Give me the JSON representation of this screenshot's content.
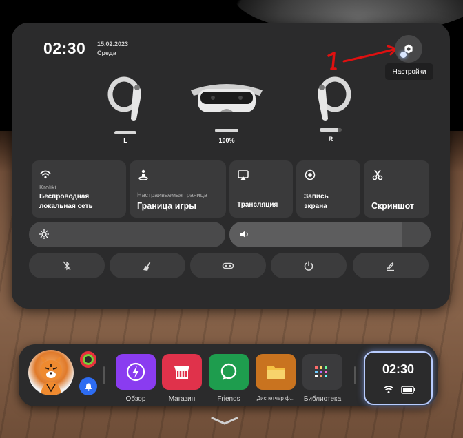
{
  "status": {
    "time": "02:30",
    "date": "15.02.2023",
    "weekday": "Среда"
  },
  "settings": {
    "tooltip": "Настройки",
    "annotation": "1"
  },
  "devices": {
    "left": {
      "label": "L",
      "battery": 1.0
    },
    "headset": {
      "label": "100%",
      "battery": 1.0
    },
    "right": {
      "label": "R",
      "battery": 0.8
    }
  },
  "tiles": {
    "wifi": {
      "sub": "Kroliki",
      "label": "Беспроводная локальная сеть",
      "icon": "wifi-icon"
    },
    "boundary": {
      "sub": "Настраиваемая граница",
      "label": "Граница игры",
      "icon": "boundary-person-icon"
    },
    "cast": {
      "label": "Трансляция",
      "icon": "cast-icon"
    },
    "record": {
      "label": "Запись экрана",
      "icon": "record-icon"
    },
    "screenshot": {
      "label": "Скриншот",
      "icon": "scissors-icon"
    }
  },
  "sliders": {
    "brightness": {
      "level": 0.0,
      "icon": "sun-icon"
    },
    "volume": {
      "level": 0.86,
      "icon": "speaker-icon"
    }
  },
  "quick_buttons": [
    "bluetooth-off-icon",
    "broom-icon",
    "gamepad-icon",
    "power-icon",
    "pen-icon"
  ],
  "dock": {
    "apps": [
      {
        "label": "Обзор",
        "icon": "bolt-icon",
        "color": "#8a3cf0"
      },
      {
        "label": "Магазин",
        "icon": "store-icon",
        "color": "#e0324b"
      },
      {
        "label": "Friends",
        "icon": "chat-icon",
        "color": "#1e9d4e"
      },
      {
        "label": "Диспетчер ф...",
        "icon": "folder-icon",
        "color": "#c9731f"
      },
      {
        "label": "Библиотека",
        "icon": "grid-icon",
        "color": "#3b3b3d"
      }
    ],
    "clock": "02:30"
  }
}
